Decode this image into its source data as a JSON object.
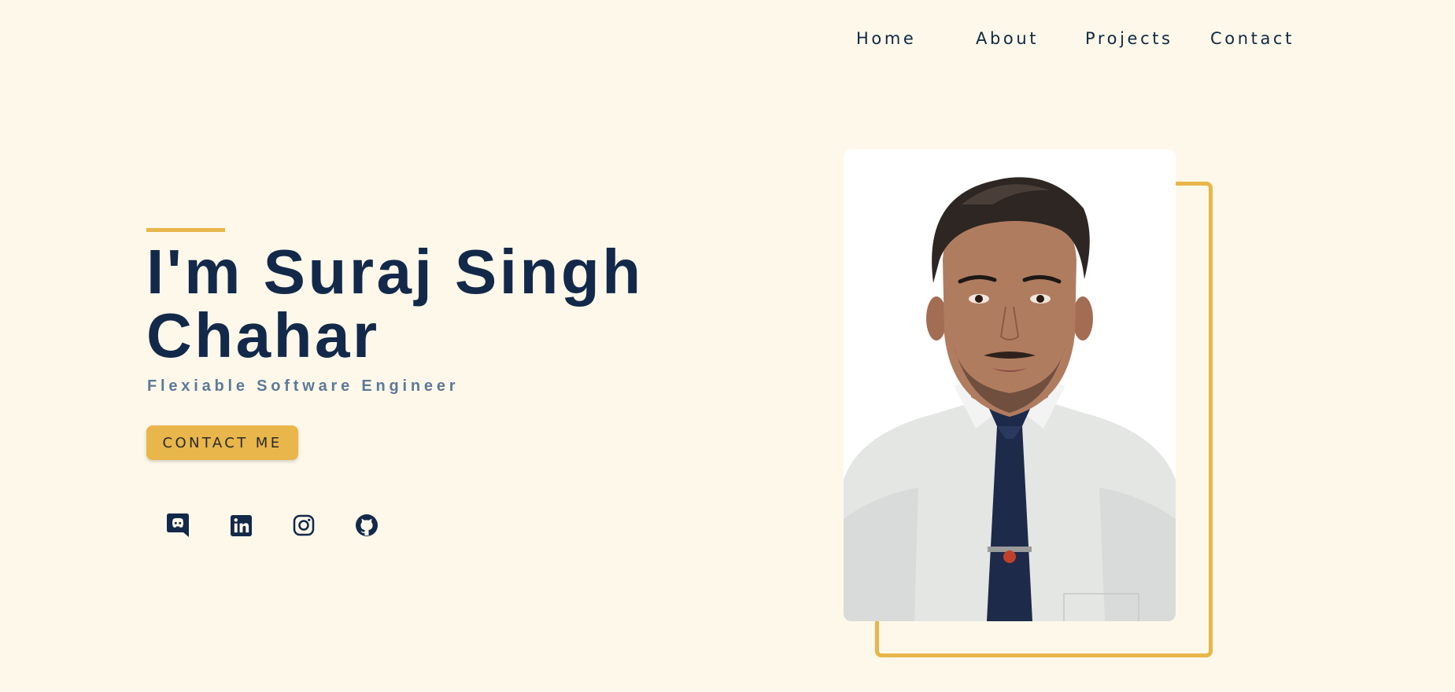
{
  "nav": {
    "items": [
      {
        "label": "Home"
      },
      {
        "label": "About"
      },
      {
        "label": "Projects"
      },
      {
        "label": "Contact"
      }
    ]
  },
  "hero": {
    "title": "I'm Suraj Singh Chahar",
    "subtitle": "Flexiable Software Engineer",
    "cta_label": "CONTACT ME"
  },
  "social": {
    "icons": [
      "discord-icon",
      "linkedin-icon",
      "instagram-icon",
      "github-icon"
    ]
  },
  "colors": {
    "background": "#fef8ea",
    "accent": "#e8b64a",
    "heading": "#13294a",
    "subtitle": "#5c7a96",
    "nav_text": "#0f2942"
  }
}
